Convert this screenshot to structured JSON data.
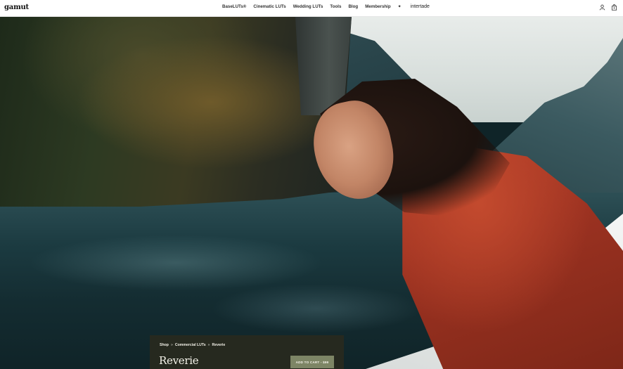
{
  "nav": {
    "logo": "gamut",
    "items": [
      "BaseLUTs®",
      "Cinematic LUTs",
      "Wedding LUTs",
      "Tools",
      "Blog",
      "Membership"
    ],
    "partner": "intertade",
    "icons": [
      "user-icon",
      "bag-icon"
    ]
  },
  "product": {
    "breadcrumb": [
      "Shop",
      "Commercial LUTs",
      "Reverie"
    ],
    "breadcrumb_sep": "»",
    "title": "Reverie",
    "cart_label": "ADD TO CART - $99"
  },
  "colors": {
    "card_bg": "#26291f",
    "cart_button": "#7d8565",
    "jacket": "#b9412a",
    "water": "#1b3a40"
  }
}
